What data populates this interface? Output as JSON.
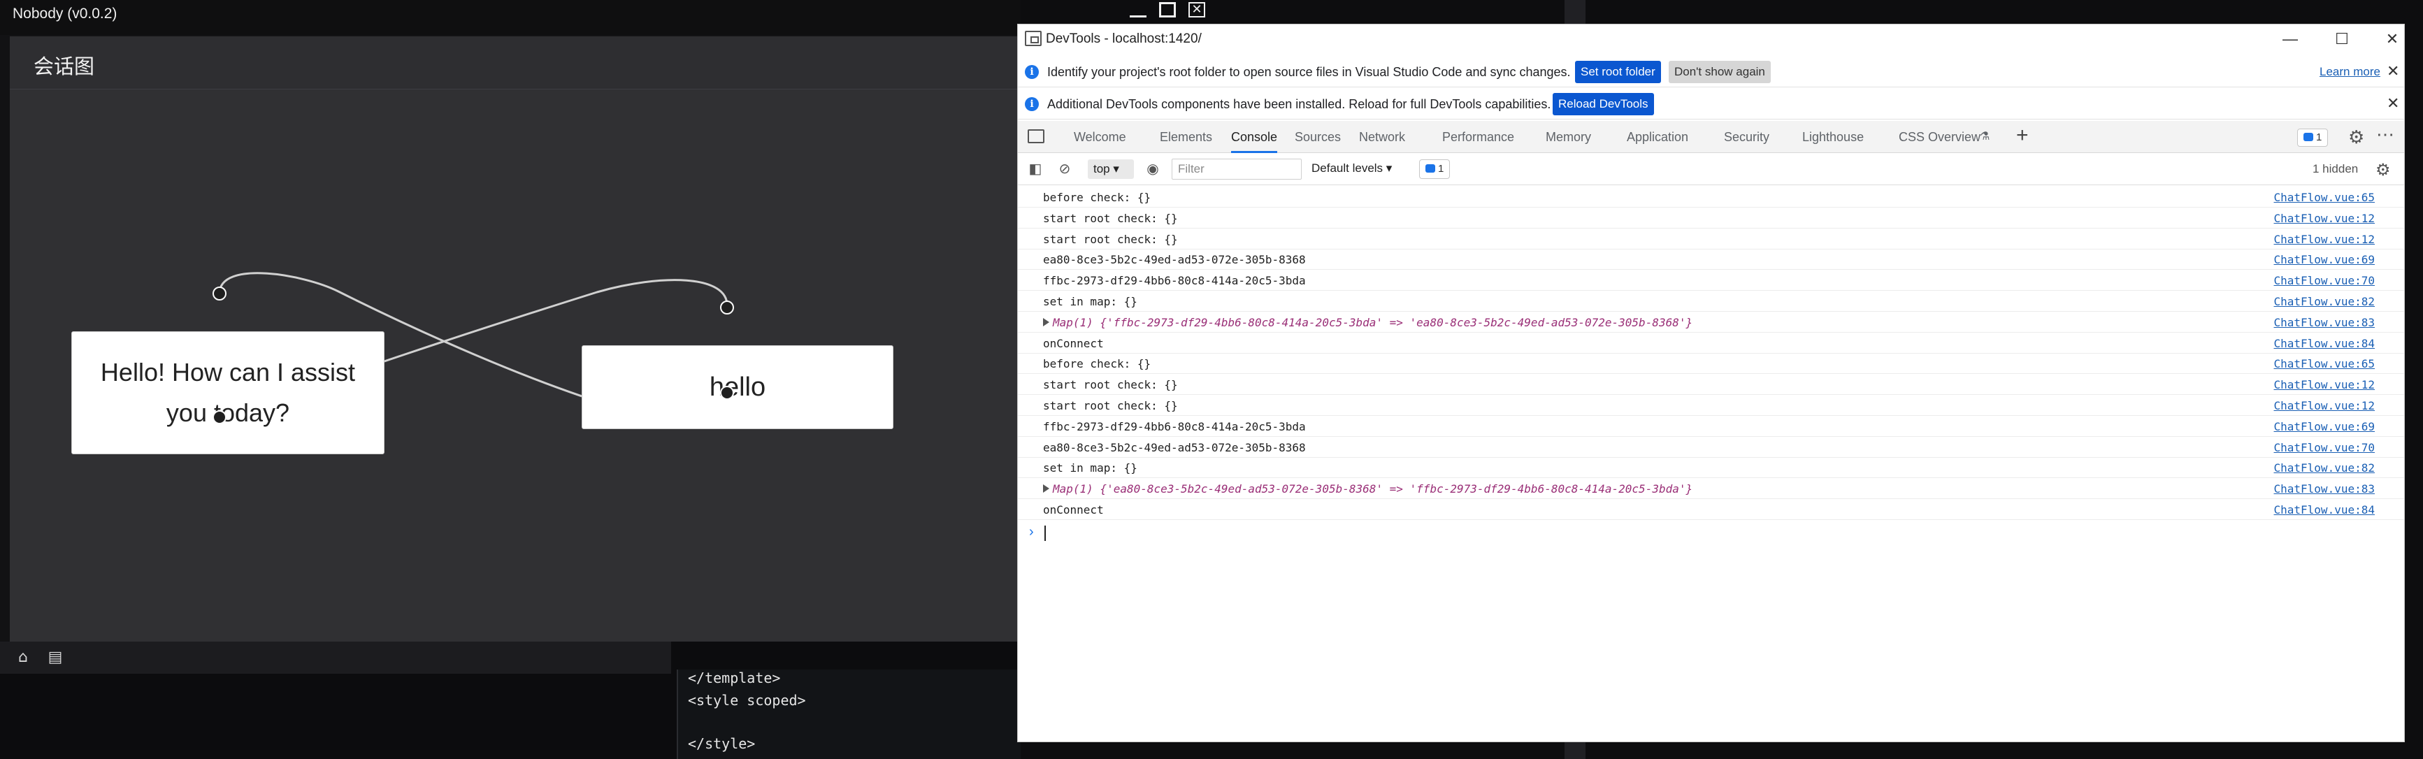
{
  "app": {
    "title": "Nobody (v0.0.2)",
    "canvas_title": "会话图",
    "close_glyph": "✕"
  },
  "flow": {
    "nodes": [
      {
        "id": "node-a",
        "label": "Hello! How can I assist you today?"
      },
      {
        "id": "node-b",
        "label": "hello"
      }
    ]
  },
  "bottom": {
    "icons": [
      "home-icon",
      "document-icon"
    ],
    "code_lines": [
      "</template>",
      "<style scoped>",
      "",
      "</style>"
    ]
  },
  "devtools": {
    "title": "DevTools - localhost:1420/",
    "window_controls": {
      "minimize": "—",
      "maximize": "☐",
      "close": "✕"
    },
    "infobar1": {
      "text": "Identify your project's root folder to open source files in Visual Studio Code and sync changes.",
      "primary": "Set root folder",
      "secondary": "Don't show again",
      "link": "Learn more"
    },
    "infobar2": {
      "text": "Additional DevTools components have been installed. Reload for full DevTools capabilities.",
      "primary": "Reload DevTools"
    },
    "close_glyph": "✕",
    "tabs": [
      "Welcome",
      "Elements",
      "Console",
      "Sources",
      "Network",
      "Performance",
      "Memory",
      "Application",
      "Security",
      "Lighthouse",
      "CSS Overview"
    ],
    "active_tab": "Console",
    "issues_count": "1",
    "toolbar": {
      "context": "top",
      "filter_placeholder": "Filter",
      "levels": "Default levels",
      "badge_count": "1",
      "hidden": "1 hidden"
    },
    "logs": [
      {
        "msg": "before check: {}",
        "src": "ChatFlow.vue:65"
      },
      {
        "msg": "start root check: {}",
        "src": "ChatFlow.vue:12"
      },
      {
        "msg": "start root check: {}",
        "src": "ChatFlow.vue:12"
      },
      {
        "msg": "ea80-8ce3-5b2c-49ed-ad53-072e-305b-8368",
        "src": "ChatFlow.vue:69"
      },
      {
        "msg": "ffbc-2973-df29-4bb6-80c8-414a-20c5-3bda",
        "src": "ChatFlow.vue:70"
      },
      {
        "msg": "set in map: {}",
        "src": "ChatFlow.vue:82"
      },
      {
        "msg": "Map(1) {'ffbc-2973-df29-4bb6-80c8-414a-20c5-3bda' => 'ea80-8ce3-5b2c-49ed-ad53-072e-305b-8368'}",
        "src": "ChatFlow.vue:83",
        "map": true
      },
      {
        "msg": "onConnect",
        "src": "ChatFlow.vue:84"
      },
      {
        "msg": "before check: {}",
        "src": "ChatFlow.vue:65"
      },
      {
        "msg": "start root check: {}",
        "src": "ChatFlow.vue:12"
      },
      {
        "msg": "start root check: {}",
        "src": "ChatFlow.vue:12"
      },
      {
        "msg": "ffbc-2973-df29-4bb6-80c8-414a-20c5-3bda",
        "src": "ChatFlow.vue:69"
      },
      {
        "msg": "ea80-8ce3-5b2c-49ed-ad53-072e-305b-8368",
        "src": "ChatFlow.vue:70"
      },
      {
        "msg": "set in map: {}",
        "src": "ChatFlow.vue:82"
      },
      {
        "msg": "Map(1) {'ea80-8ce3-5b2c-49ed-ad53-072e-305b-8368' => 'ffbc-2973-df29-4bb6-80c8-414a-20c5-3bda'}",
        "src": "ChatFlow.vue:83",
        "map": true
      },
      {
        "msg": "onConnect",
        "src": "ChatFlow.vue:84"
      }
    ],
    "prompt": "›"
  },
  "colors": {
    "accent": "#1a73e8",
    "primary_button": "#0b57d0",
    "map_text": "#9a2f77",
    "link": "#1a5fb4"
  }
}
